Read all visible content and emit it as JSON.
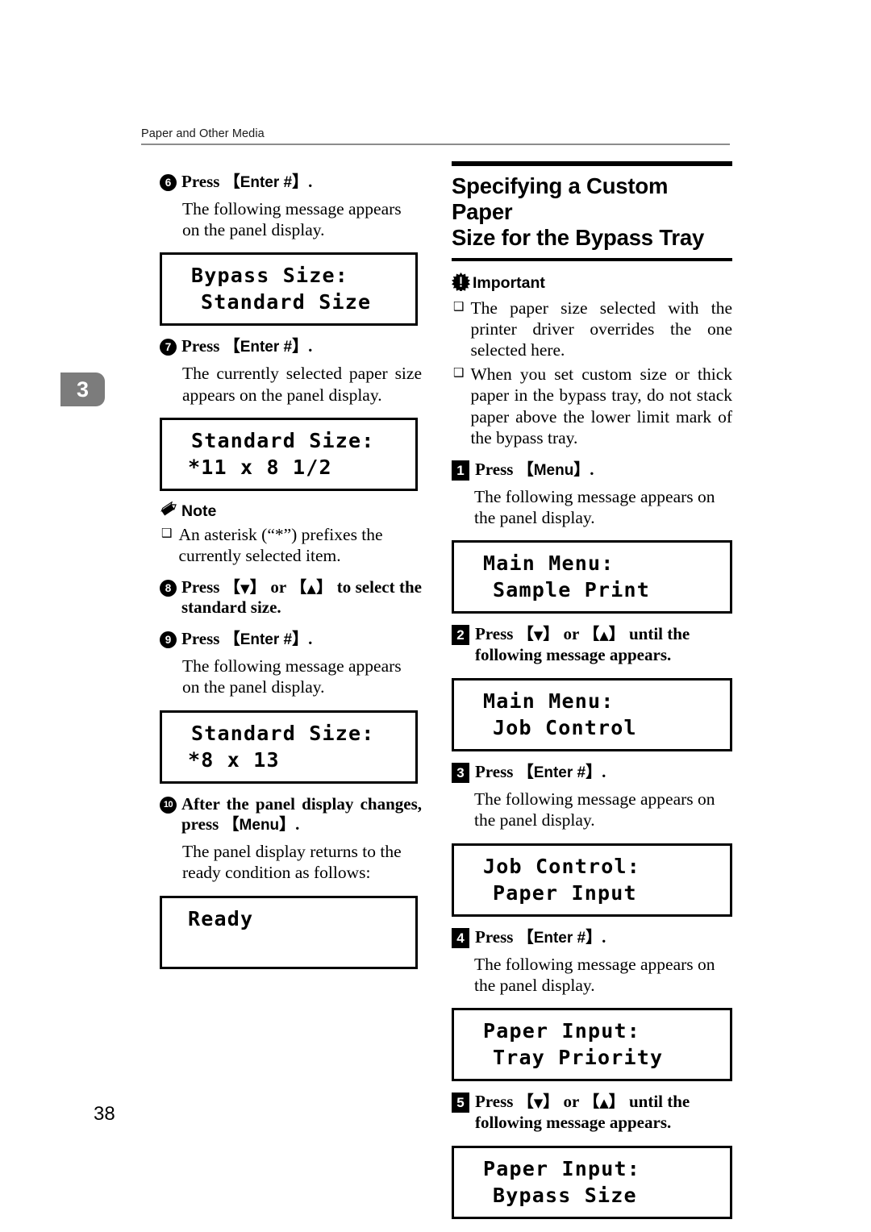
{
  "header": {
    "running_title": "Paper and Other Media"
  },
  "chapter_tab": {
    "number": "3"
  },
  "footer": {
    "page_number": "38"
  },
  "left_column": {
    "steps": [
      {
        "number": "6",
        "instruction_prefix": "Press",
        "key": "Enter #",
        "instruction_suffix": ".",
        "body": "The following message appears on the panel display.",
        "lcd": {
          "line1": "Bypass Size:",
          "line2": "Standard Size"
        }
      },
      {
        "number": "7",
        "instruction_prefix": "Press",
        "key": "Enter #",
        "instruction_suffix": ".",
        "body": "The currently selected paper size appears on the panel display.",
        "lcd": {
          "line1": "Standard Size:",
          "line2": "*11 x 8 1/2"
        }
      }
    ],
    "note": {
      "label": "Note",
      "icon": "pencil-icon",
      "items": [
        "An asterisk (“*”) prefixes the currently selected item."
      ]
    },
    "step8": {
      "number": "8",
      "text_before": "Press",
      "key_down": "▼",
      "between": "or",
      "key_up": "▲",
      "text_after": "to select the standard size."
    },
    "step9": {
      "number": "9",
      "instruction_prefix": "Press",
      "key": "Enter #",
      "instruction_suffix": ".",
      "body": "The following message appears on the panel display.",
      "lcd": {
        "line1": "Standard Size:",
        "line2": "*8 x 13"
      }
    },
    "step10": {
      "number": "10",
      "text_before": "After the panel display changes, press",
      "key": "Menu",
      "text_after": ".",
      "body": "The panel display returns to the ready condition as follows:",
      "lcd": {
        "line1": "Ready",
        "line2": ""
      }
    }
  },
  "right_column": {
    "section_title_line1": "Specifying a Custom Paper",
    "section_title_line2": "Size for the Bypass Tray",
    "important": {
      "label": "Important",
      "icon": "important-icon",
      "items": [
        "The paper size selected with the printer driver overrides the one selected here.",
        "When you set custom size or thick paper in the bypass tray, do not stack paper above the lower limit mark of the bypass tray."
      ]
    },
    "steps": [
      {
        "number": "1",
        "instruction_prefix": "Press",
        "key": "Menu",
        "instruction_suffix": ".",
        "body": "The following message appears on the panel display.",
        "lcd": {
          "line1": "Main Menu:",
          "line2": "Sample Print"
        }
      },
      {
        "number": "2",
        "text_before": "Press",
        "key_down": "▼",
        "between": "or",
        "key_up": "▲",
        "text_after": "until the following message appears.",
        "lcd": {
          "line1": "Main Menu:",
          "line2": "Job Control"
        }
      },
      {
        "number": "3",
        "instruction_prefix": "Press",
        "key": "Enter #",
        "instruction_suffix": ".",
        "body": "The following message appears on the panel display.",
        "lcd": {
          "line1": "Job Control:",
          "line2": "Paper Input"
        }
      },
      {
        "number": "4",
        "instruction_prefix": "Press",
        "key": "Enter #",
        "instruction_suffix": ".",
        "body": "The following message appears on the panel display.",
        "lcd": {
          "line1": "Paper Input:",
          "line2": "Tray Priority"
        }
      },
      {
        "number": "5",
        "text_before": "Press",
        "key_down": "▼",
        "between": "or",
        "key_up": "▲",
        "text_after": "until the following message appears.",
        "lcd": {
          "line1": "Paper Input:",
          "line2": "Bypass Size"
        }
      }
    ]
  },
  "symbols": {
    "bracket_open": "【",
    "bracket_close": "】",
    "square_bullet": "❑"
  }
}
